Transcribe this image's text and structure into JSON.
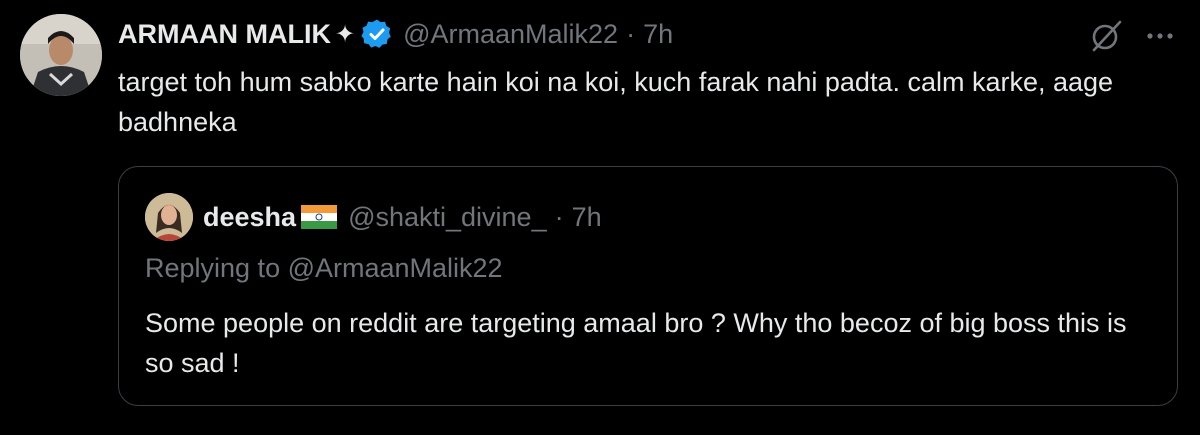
{
  "tweet": {
    "author_name": "ARMAAN MALIK",
    "author_name_symbol": "✦",
    "handle": "@ArmaanMalik22",
    "separator": "·",
    "time": "7h",
    "text": "target toh hum sabko karte hain koi na koi, kuch farak nahi padta. calm karke, aage badhneka",
    "icons": [
      "avatar",
      "verified-badge-icon",
      "grok-icon",
      "more-icon"
    ]
  },
  "quote": {
    "author_name": "deesha",
    "flag_icon": "india-flag-icon",
    "handle": "@shakti_divine_",
    "separator": "·",
    "time": "7h",
    "replying_to": "Replying to @ArmaanMalik22",
    "text": "Some people  on reddit are targeting  amaal bro ? Why tho becoz of big boss this is so sad !"
  },
  "colors": {
    "background": "#000000",
    "primary_text": "#e7e9ea",
    "secondary_text": "#71767b",
    "verified": "#1d9bf0",
    "border": "#3a3f44"
  }
}
